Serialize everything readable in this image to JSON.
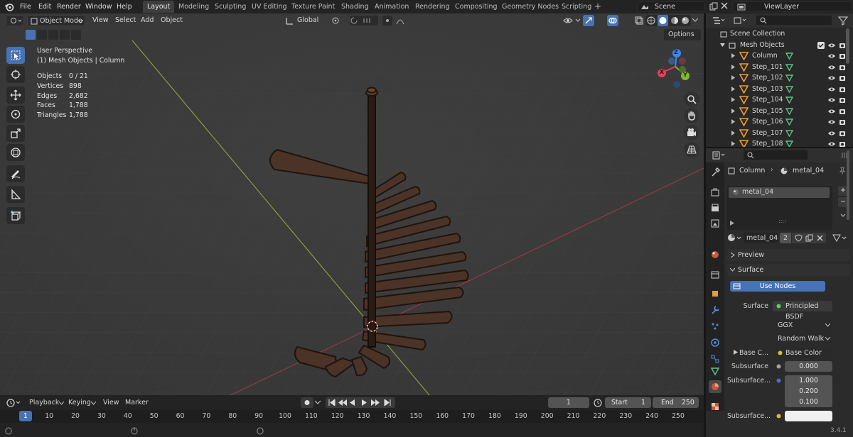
{
  "topbar": {
    "menus": [
      "File",
      "Edit",
      "Render",
      "Window",
      "Help"
    ],
    "workspaces": [
      "Layout",
      "Modeling",
      "Sculpting",
      "UV Editing",
      "Texture Paint",
      "Shading",
      "Animation",
      "Rendering",
      "Compositing",
      "Geometry Nodes",
      "Scripting"
    ],
    "active_workspace": "Layout",
    "add_tab": "+",
    "scene": "Scene",
    "view_layer": "ViewLayer"
  },
  "viewport": {
    "mode": "Object Mode",
    "menus": [
      "View",
      "Select",
      "Add",
      "Object"
    ],
    "transform_orientation": "Global",
    "options_label": "Options",
    "view_name": "User Perspective",
    "collection_info": "(1) Mesh Objects | Column",
    "stats": [
      {
        "label": "Objects",
        "value": "0 / 21"
      },
      {
        "label": "Vertices",
        "value": "898"
      },
      {
        "label": "Edges",
        "value": "2,682"
      },
      {
        "label": "Faces",
        "value": "1,788"
      },
      {
        "label": "Triangles",
        "value": "1,788"
      }
    ],
    "gizmo": {
      "x": "X",
      "y": "Y",
      "z": "Z"
    }
  },
  "outliner": {
    "scene_collection": "Scene Collection",
    "collection": "Mesh Objects",
    "items": [
      "Column",
      "Step_101",
      "Step_102",
      "Step_103",
      "Step_104",
      "Step_105",
      "Step_106",
      "Step_107",
      "Step_108"
    ]
  },
  "properties": {
    "breadcrumb_object": "Column",
    "breadcrumb_material": "metal_04",
    "slot_material": "metal_04",
    "material_name": "metal_04",
    "user_count": "2",
    "preview_label": "Preview",
    "surface_label": "Surface",
    "use_nodes_label": "Use Nodes",
    "surface_field_label": "Surface",
    "surface_shader": "Principled BSDF",
    "distribution": "GGX",
    "subsurface_method": "Random Walk",
    "base_color_label": "Base C...",
    "base_color_value": "Base Color",
    "subsurface_label": "Subsurface",
    "subsurface_value": "0.000",
    "subsurface_radius_label": "Subsurface...",
    "subsurface_radius": [
      "1.000",
      "0.200",
      "0.100"
    ],
    "subsurface_color_label": "Subsurface..."
  },
  "timeline": {
    "menus": [
      "Playback",
      "Keying",
      "View",
      "Marker"
    ],
    "current_frame": "1",
    "start_label": "Start",
    "start_value": "1",
    "end_label": "End",
    "end_value": "250",
    "ruler": [
      "1",
      "10",
      "20",
      "30",
      "40",
      "50",
      "60",
      "70",
      "80",
      "90",
      "100",
      "110",
      "120",
      "130",
      "140",
      "150",
      "160",
      "170",
      "180",
      "190",
      "200",
      "210",
      "220",
      "230",
      "240",
      "250"
    ],
    "version": "3.4.1"
  },
  "colors": {
    "accent": "#4772b3",
    "x_axis": "#e0405b",
    "y_axis": "#83b82a",
    "z_axis": "#3f86e8",
    "object_orange": "#e59b3f",
    "mesh_green": "#5fc08a"
  }
}
